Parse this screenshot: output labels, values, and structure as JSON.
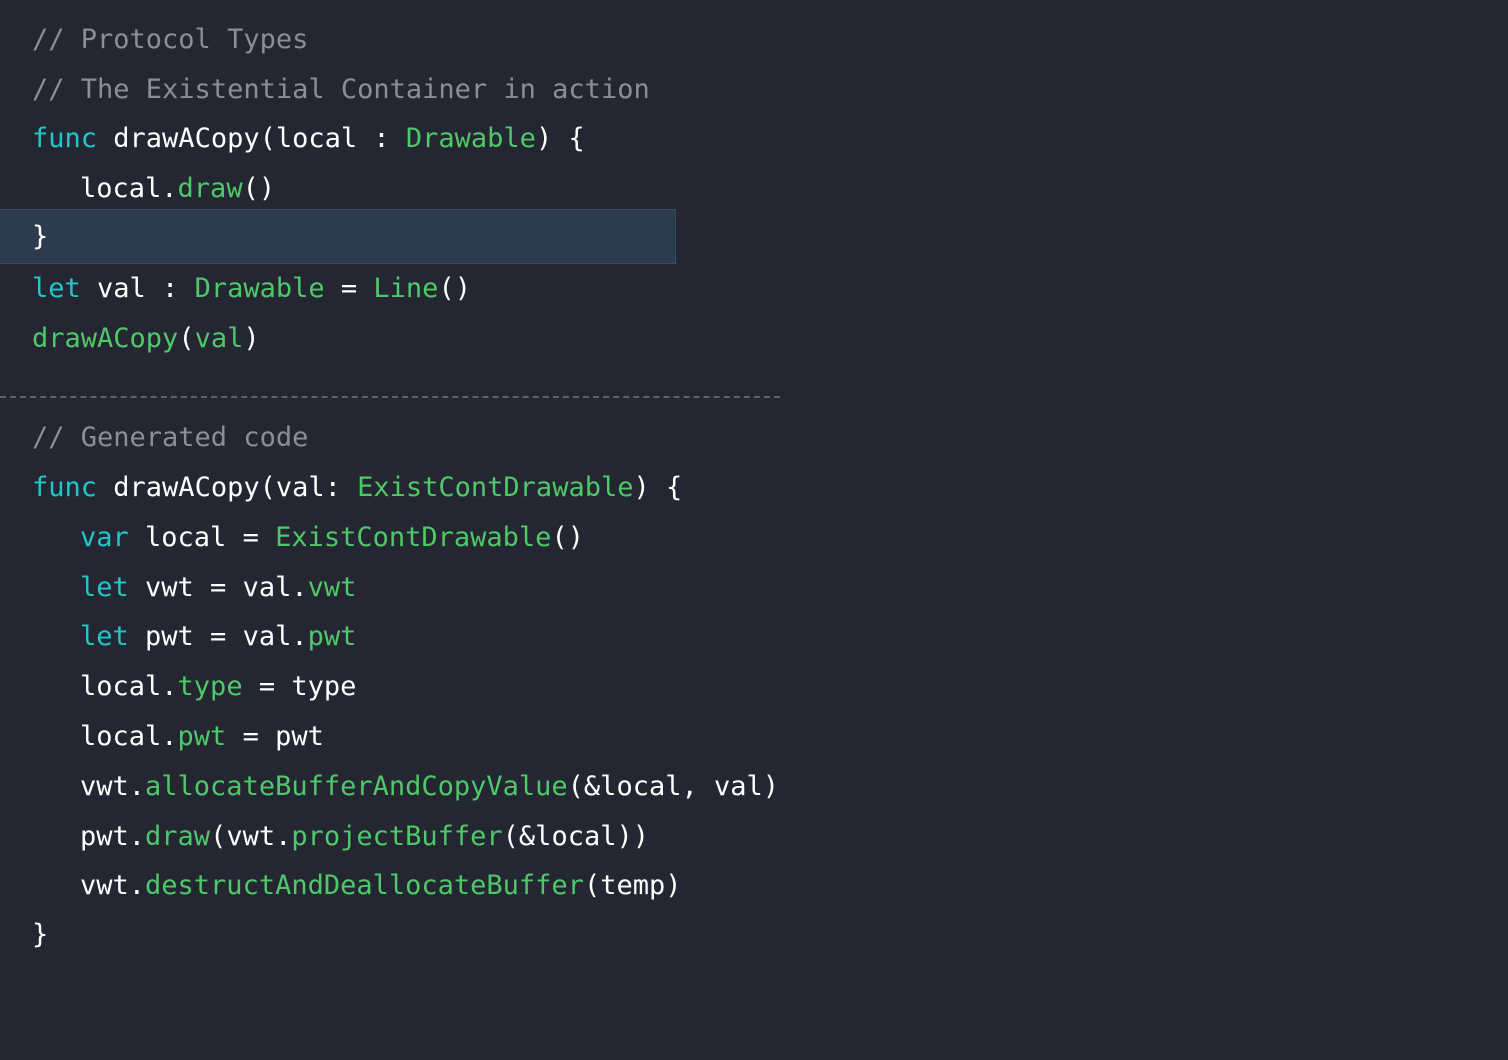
{
  "theme": {
    "background": "#242732",
    "highlight_line": "#2c3b4e",
    "comment": "#8b8e99",
    "keyword": "#1ec8c8",
    "identifier_green": "#4ec868",
    "plain": "#ffffff",
    "separator": "#5d6170"
  },
  "code": {
    "line01": {
      "t0": "// Protocol Types"
    },
    "line02": {
      "t0": "// The Existential Container in action"
    },
    "line03": {
      "t0": "func",
      "t1": " drawACopy(local : ",
      "t2": "Drawable",
      "t3": ") {"
    },
    "line04": {
      "t0": "local.",
      "t1": "draw",
      "t2": "()"
    },
    "line05": {
      "t0": "}"
    },
    "line06": {
      "t0": "let",
      "t1": " val : ",
      "t2": "Drawable",
      "t3": " = ",
      "t4": "Line",
      "t5": "()"
    },
    "line07": {
      "t0": "drawACopy",
      "t1": "(",
      "t2": "val",
      "t3": ")"
    },
    "line08": {
      "t0": "// Generated code"
    },
    "line09": {
      "t0": "func",
      "t1": " drawACopy(val: ",
      "t2": "ExistContDrawable",
      "t3": ") {"
    },
    "line10": {
      "t0": "var",
      "t1": " local = ",
      "t2": "ExistContDrawable",
      "t3": "()"
    },
    "line11": {
      "t0": "let",
      "t1": " vwt = val.",
      "t2": "vwt"
    },
    "line12": {
      "t0": "let",
      "t1": " pwt = val.",
      "t2": "pwt"
    },
    "line13": {
      "t0": "local.",
      "t1": "type",
      "t2": " = type"
    },
    "line14": {
      "t0": "local.",
      "t1": "pwt",
      "t2": " = pwt"
    },
    "line15": {
      "t0": "vwt.",
      "t1": "allocateBufferAndCopyValue",
      "t2": "(&local, val)"
    },
    "line16": {
      "t0": "pwt.",
      "t1": "draw",
      "t2": "(vwt.",
      "t3": "projectBuffer",
      "t4": "(&local))"
    },
    "line17": {
      "t0": "vwt.",
      "t1": "destructAndDeallocateBuffer",
      "t2": "(temp)"
    },
    "line18": {
      "t0": "}"
    }
  }
}
